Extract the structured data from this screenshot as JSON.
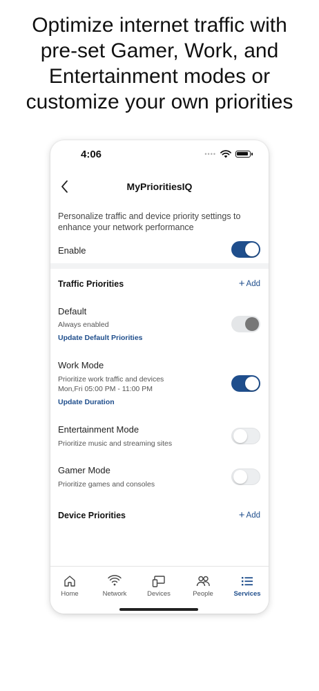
{
  "headline": {
    "line1": "Optimize internet traffic with",
    "line2": "pre-set Gamer, Work, and",
    "line3": "Entertainment modes or",
    "line4": "customize your own priorities"
  },
  "status_bar": {
    "time": "4:06",
    "icons": [
      "signal-dots-icon",
      "wifi-icon",
      "battery-icon"
    ]
  },
  "nav": {
    "title": "MyPrioritiesIQ",
    "back_icon": "chevron-left-icon"
  },
  "intro_text": "Personalize traffic and device priority settings to enhance your network performance",
  "enable": {
    "label": "Enable",
    "state": "on"
  },
  "traffic_priorities": {
    "title": "Traffic Priorities",
    "add_label": "Add",
    "items": [
      {
        "title": "Default",
        "desc": "Always enabled",
        "link": "Update Default Priorities",
        "state": "locked-on"
      },
      {
        "title": "Work Mode",
        "desc": "Prioritize work traffic and devices",
        "schedule": "Mon,Fri 05:00 PM - 11:00 PM",
        "link": "Update Duration",
        "state": "on"
      },
      {
        "title": "Entertainment Mode",
        "desc": "Prioritize music and streaming sites",
        "state": "off"
      },
      {
        "title": "Gamer Mode",
        "desc": "Prioritize games and consoles",
        "state": "off"
      }
    ]
  },
  "device_priorities": {
    "title": "Device Priorities",
    "add_label": "Add"
  },
  "tabbar": {
    "tabs": [
      {
        "label": "Home",
        "icon": "home-icon"
      },
      {
        "label": "Network",
        "icon": "wifi-icon"
      },
      {
        "label": "Devices",
        "icon": "devices-icon"
      },
      {
        "label": "People",
        "icon": "people-icon"
      },
      {
        "label": "Services",
        "icon": "list-icon",
        "active": true
      }
    ]
  },
  "colors": {
    "accent": "#1f4e8c",
    "toggle_off": "#eceef0",
    "locked_knob": "#777777"
  }
}
